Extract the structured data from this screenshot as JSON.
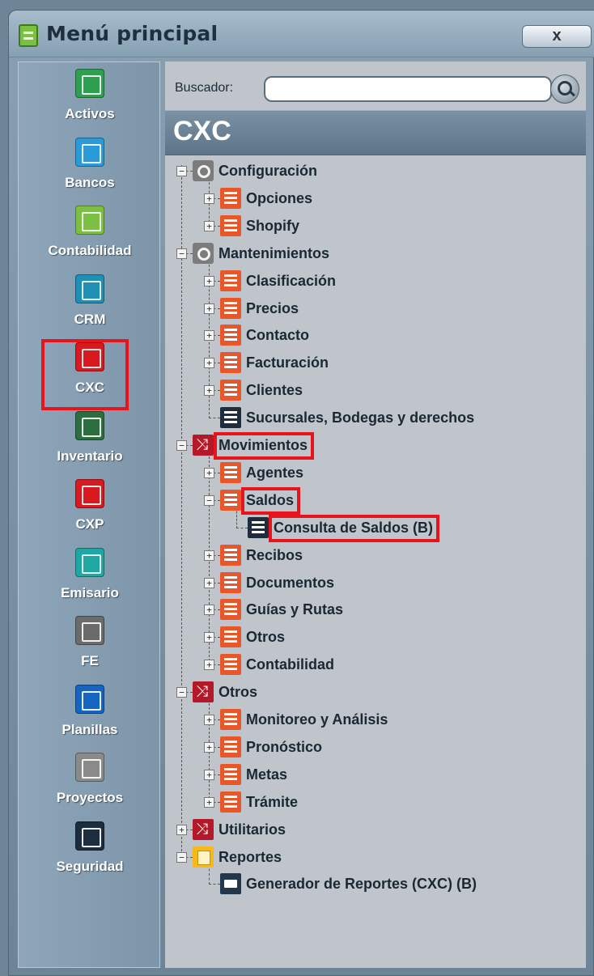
{
  "window": {
    "title": "Menú principal",
    "close_label": "x"
  },
  "modules": [
    {
      "label": "Activos",
      "icon": "cash-register-icon",
      "color": "#2e9e4f"
    },
    {
      "label": "Bancos",
      "icon": "briefcase-icon",
      "color": "#2a9ad8"
    },
    {
      "label": "Contabilidad",
      "icon": "chart-icon",
      "color": "#7bc043"
    },
    {
      "label": "CRM",
      "icon": "globe-icon",
      "color": "#1e8fb5"
    },
    {
      "label": "CXC",
      "icon": "receivable-person-icon",
      "color": "#d71920",
      "selected": true
    },
    {
      "label": "Inventario",
      "icon": "inventory-icon",
      "color": "#2d6e3e"
    },
    {
      "label": "CXP",
      "icon": "payable-person-icon",
      "color": "#d71920"
    },
    {
      "label": "Emisario",
      "icon": "envelope-icon",
      "color": "#1fa7a3"
    },
    {
      "label": "FE",
      "icon": "tools-icon",
      "color": "#6b6b6b"
    },
    {
      "label": "Planillas",
      "icon": "payroll-doc-icon",
      "color": "#1565c0"
    },
    {
      "label": "Proyectos",
      "icon": "project-tools-icon",
      "color": "#8a8a8a"
    },
    {
      "label": "Seguridad",
      "icon": "castle-icon",
      "color": "#1d2d3d"
    }
  ],
  "search": {
    "label": "Buscador:",
    "value": "",
    "placeholder": ""
  },
  "module_header": "CXC",
  "tree": [
    {
      "label": "Configuración",
      "icon": "gear-icon",
      "level": 0,
      "toggle": "−"
    },
    {
      "label": "Opciones",
      "icon": "list-icon",
      "level": 1,
      "toggle": "+"
    },
    {
      "label": "Shopify",
      "icon": "list-icon",
      "level": 1,
      "toggle": "+"
    },
    {
      "label": "Mantenimientos",
      "icon": "gear-icon",
      "level": 0,
      "toggle": "−"
    },
    {
      "label": "Clasificación",
      "icon": "list-icon",
      "level": 1,
      "toggle": "+"
    },
    {
      "label": "Precios",
      "icon": "list-icon",
      "level": 1,
      "toggle": "+"
    },
    {
      "label": "Contacto",
      "icon": "list-icon",
      "level": 1,
      "toggle": "+"
    },
    {
      "label": "Facturación",
      "icon": "list-icon",
      "level": 1,
      "toggle": "+"
    },
    {
      "label": "Clientes",
      "icon": "list-icon",
      "level": 1,
      "toggle": "+"
    },
    {
      "label": "Sucursales, Bodegas y derechos",
      "icon": "document-icon",
      "level": 1,
      "toggle": ""
    },
    {
      "label": "Movimientos",
      "icon": "shuffle-icon",
      "level": 0,
      "toggle": "−",
      "highlight": true
    },
    {
      "label": "Agentes",
      "icon": "list-icon",
      "level": 1,
      "toggle": "+"
    },
    {
      "label": "Saldos",
      "icon": "list-icon",
      "level": 1,
      "toggle": "−",
      "highlight": true
    },
    {
      "label": "Consulta de Saldos (B)",
      "icon": "document-icon",
      "level": 2,
      "toggle": "",
      "highlight": true
    },
    {
      "label": "Recibos",
      "icon": "list-icon",
      "level": 1,
      "toggle": "+"
    },
    {
      "label": "Documentos",
      "icon": "list-icon",
      "level": 1,
      "toggle": "+"
    },
    {
      "label": "Guías y Rutas",
      "icon": "list-icon",
      "level": 1,
      "toggle": "+"
    },
    {
      "label": "Otros",
      "icon": "list-icon",
      "level": 1,
      "toggle": "+"
    },
    {
      "label": "Contabilidad",
      "icon": "list-icon",
      "level": 1,
      "toggle": "+"
    },
    {
      "label": "Otros",
      "icon": "shuffle-icon",
      "level": 0,
      "toggle": "−"
    },
    {
      "label": "Monitoreo y Análisis",
      "icon": "list-icon",
      "level": 1,
      "toggle": "+"
    },
    {
      "label": "Pronóstico",
      "icon": "list-icon",
      "level": 1,
      "toggle": "+"
    },
    {
      "label": "Metas",
      "icon": "list-icon",
      "level": 1,
      "toggle": "+"
    },
    {
      "label": "Trámite",
      "icon": "list-icon",
      "level": 1,
      "toggle": "+"
    },
    {
      "label": "Utilitarios",
      "icon": "shuffle-icon",
      "level": 0,
      "toggle": "+"
    },
    {
      "label": "Reportes",
      "icon": "notes-icon",
      "level": 0,
      "toggle": "−"
    },
    {
      "label": "Generador de Reportes (CXC) (B)",
      "icon": "printer-icon",
      "level": 1,
      "toggle": ""
    }
  ],
  "colors": {
    "highlight": "#e8141c",
    "list_icon": "#e8562a",
    "header_bg": "#6a8194"
  }
}
